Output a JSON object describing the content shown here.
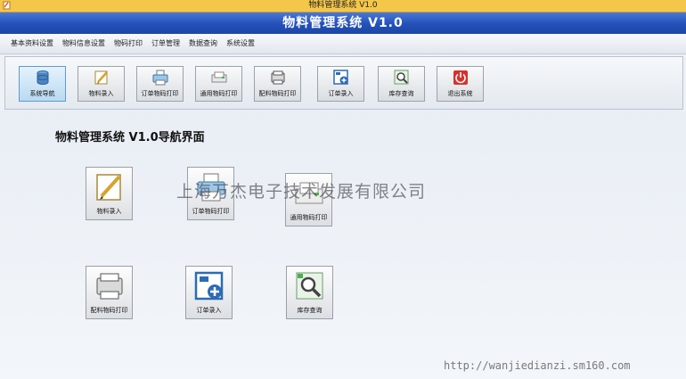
{
  "window": {
    "title": "物料管理系统 V1.0"
  },
  "banner": {
    "title": "物料管理系统 V1.0"
  },
  "menu": {
    "items": [
      "基本资料设置",
      "物料信息设置",
      "物码打印",
      "订单管理",
      "数据查询",
      "系统设置"
    ]
  },
  "toolbar": {
    "buttons": [
      {
        "label": "系统导航",
        "icon": "database-icon",
        "active": true
      },
      {
        "label": "物料录入",
        "icon": "pencil-note-icon"
      },
      {
        "label": "订单物码打印",
        "icon": "printer-icon"
      },
      {
        "label": "通用物码打印",
        "icon": "label-printer-icon"
      },
      {
        "label": "配料物码打印",
        "icon": "printer-icon"
      },
      {
        "label": "订单录入",
        "icon": "add-order-icon"
      },
      {
        "label": "库存查询",
        "icon": "magnifier-icon"
      },
      {
        "label": "退出系统",
        "icon": "power-icon"
      }
    ]
  },
  "nav": {
    "heading": "物料管理系统 V1.0导航界面",
    "cards": [
      {
        "label": "物料录入",
        "icon": "pencil-note-icon"
      },
      {
        "label": "订单物码打印",
        "icon": "printer-icon"
      },
      {
        "label": "通用物码打印",
        "icon": "label-printer-icon"
      },
      {
        "label": "配料物码打印",
        "icon": "printer-icon"
      },
      {
        "label": "订单录入",
        "icon": "add-order-icon"
      },
      {
        "label": "库存查询",
        "icon": "magnifier-icon"
      }
    ]
  },
  "watermark": {
    "company": "上海万杰电子技术发展有限公司",
    "url": "http://wanjiedianzi.sm160.com"
  },
  "colors": {
    "banner": "#2350b8",
    "title_bar": "#f4c64a",
    "exit": "#d9302c"
  }
}
